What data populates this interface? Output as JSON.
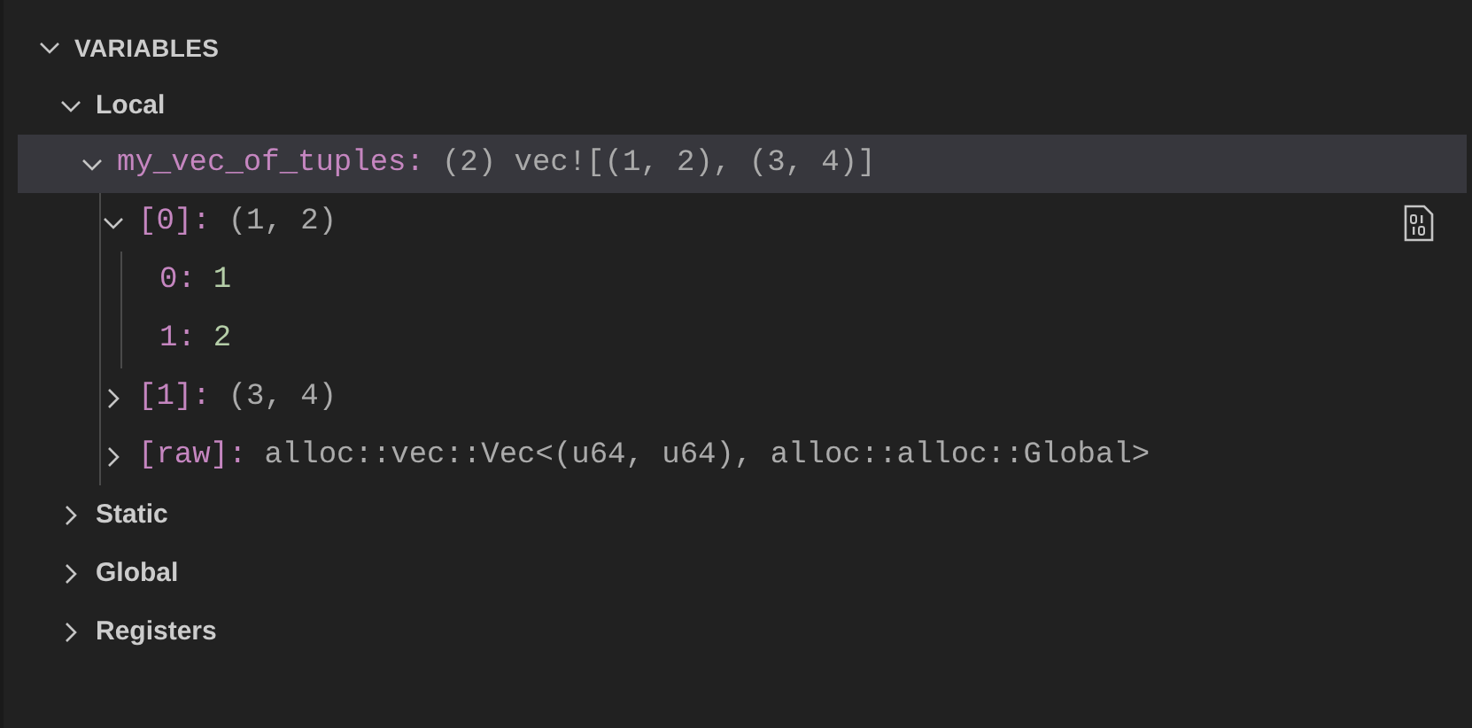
{
  "panel": {
    "title": "VARIABLES",
    "expanded": true
  },
  "scopes": [
    {
      "label": "Local",
      "expanded": true,
      "variables": [
        {
          "name": "my_vec_of_tuples:",
          "value": "(2) vec![(1, 2), (3, 4)]",
          "kind": "text",
          "expanded": true,
          "selected": true,
          "children": [
            {
              "name": "[0]:",
              "value": "(1, 2)",
              "kind": "text",
              "expanded": true,
              "selected": false,
              "binary_view_icon": true,
              "children": [
                {
                  "name": "0:",
                  "value": "1",
                  "kind": "number",
                  "selected": false
                },
                {
                  "name": "1:",
                  "value": "2",
                  "kind": "number",
                  "selected": false
                }
              ]
            },
            {
              "name": "[1]:",
              "value": "(3, 4)",
              "kind": "text",
              "expanded": false,
              "selected": false
            },
            {
              "name": "[raw]:",
              "value": "alloc::vec::Vec<(u64, u64), alloc::alloc::Global>",
              "kind": "text",
              "expanded": false,
              "selected": false
            }
          ]
        }
      ]
    },
    {
      "label": "Static",
      "expanded": false
    },
    {
      "label": "Global",
      "expanded": false
    },
    {
      "label": "Registers",
      "expanded": false
    }
  ]
}
